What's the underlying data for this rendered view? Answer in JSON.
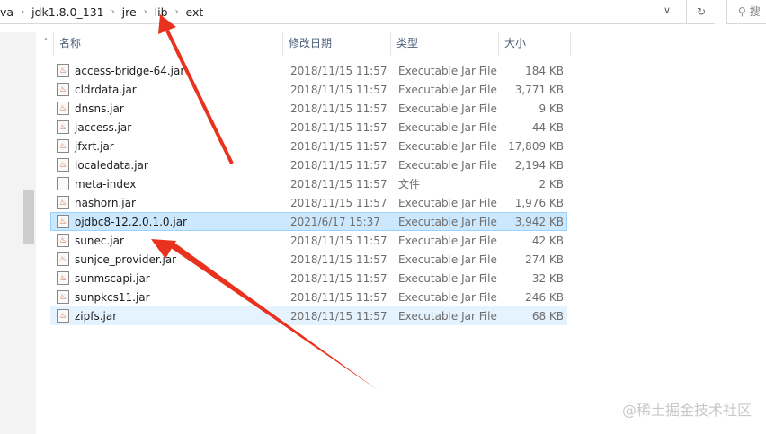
{
  "breadcrumb": [
    "va",
    "jdk1.8.0_131",
    "jre",
    "lib",
    "ext"
  ],
  "search_placeholder": "搜",
  "headers": {
    "name": "名称",
    "date": "修改日期",
    "type": "类型",
    "size": "大小"
  },
  "files": [
    {
      "name": "access-bridge-64.jar",
      "date": "2018/11/15 11:57",
      "type": "Executable Jar File",
      "size": "184 KB",
      "icon": "jar-icon"
    },
    {
      "name": "cldrdata.jar",
      "date": "2018/11/15 11:57",
      "type": "Executable Jar File",
      "size": "3,771 KB",
      "icon": "jar-icon"
    },
    {
      "name": "dnsns.jar",
      "date": "2018/11/15 11:57",
      "type": "Executable Jar File",
      "size": "9 KB",
      "icon": "jar-icon"
    },
    {
      "name": "jaccess.jar",
      "date": "2018/11/15 11:57",
      "type": "Executable Jar File",
      "size": "44 KB",
      "icon": "jar-icon"
    },
    {
      "name": "jfxrt.jar",
      "date": "2018/11/15 11:57",
      "type": "Executable Jar File",
      "size": "17,809 KB",
      "icon": "jar-icon"
    },
    {
      "name": "localedata.jar",
      "date": "2018/11/15 11:57",
      "type": "Executable Jar File",
      "size": "2,194 KB",
      "icon": "jar-icon"
    },
    {
      "name": "meta-index",
      "date": "2018/11/15 11:57",
      "type": "文件",
      "size": "2 KB",
      "icon": "file-icon"
    },
    {
      "name": "nashorn.jar",
      "date": "2018/11/15 11:57",
      "type": "Executable Jar File",
      "size": "1,976 KB",
      "icon": "jar-icon"
    },
    {
      "name": "ojdbc8-12.2.0.1.0.jar",
      "date": "2021/6/17 15:37",
      "type": "Executable Jar File",
      "size": "3,942 KB",
      "icon": "jar-icon",
      "state": "sel"
    },
    {
      "name": "sunec.jar",
      "date": "2018/11/15 11:57",
      "type": "Executable Jar File",
      "size": "42 KB",
      "icon": "jar-icon"
    },
    {
      "name": "sunjce_provider.jar",
      "date": "2018/11/15 11:57",
      "type": "Executable Jar File",
      "size": "274 KB",
      "icon": "jar-icon"
    },
    {
      "name": "sunmscapi.jar",
      "date": "2018/11/15 11:57",
      "type": "Executable Jar File",
      "size": "32 KB",
      "icon": "jar-icon"
    },
    {
      "name": "sunpkcs11.jar",
      "date": "2018/11/15 11:57",
      "type": "Executable Jar File",
      "size": "246 KB",
      "icon": "jar-icon"
    },
    {
      "name": "zipfs.jar",
      "date": "2018/11/15 11:57",
      "type": "Executable Jar File",
      "size": "68 KB",
      "icon": "jar-icon",
      "state": "hov"
    }
  ],
  "watermark": "@稀土掘金技术社区",
  "arrow_color": "#e8321e"
}
